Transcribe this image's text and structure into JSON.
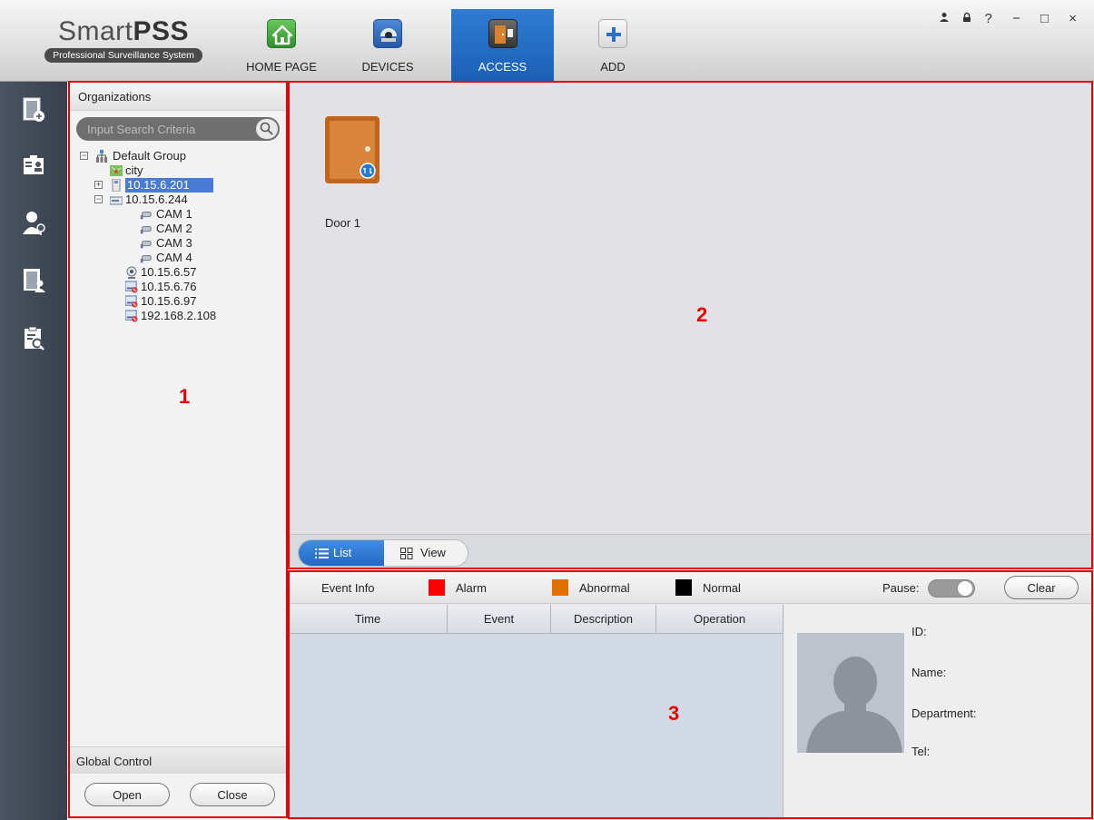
{
  "app": {
    "logo_title_light": "Smart",
    "logo_title_bold": "PSS",
    "logo_subtitle": "Professional Surveillance System"
  },
  "nav": {
    "tabs": [
      {
        "label": "HOME PAGE",
        "icon": "home-icon"
      },
      {
        "label": "DEVICES",
        "icon": "camera-dome-icon"
      },
      {
        "label": "ACCESS",
        "icon": "door-access-icon",
        "active": true
      },
      {
        "label": "ADD",
        "icon": "plus-icon"
      }
    ]
  },
  "window_controls": {
    "user": "user-icon",
    "lock": "lock-icon",
    "help": "?",
    "minimize": "−",
    "maximize": "□",
    "close": "×"
  },
  "rail": {
    "items": [
      "door-status-icon",
      "person-card-icon",
      "user-key-icon",
      "door-person-icon",
      "log-search-icon"
    ]
  },
  "panel1": {
    "title": "Organizations",
    "search_placeholder": "Input Search Criteria",
    "tree": {
      "root": "Default Group",
      "items": [
        {
          "label": "city",
          "icon": "map-icon"
        },
        {
          "label": "10.15.6.201",
          "icon": "access-controller-icon",
          "selected": true,
          "toggle": "+"
        },
        {
          "label": "10.15.6.244",
          "icon": "nvr-icon",
          "toggle": "−"
        },
        {
          "label": "CAM 1",
          "icon": "camera-icon"
        },
        {
          "label": "CAM 2",
          "icon": "camera-icon"
        },
        {
          "label": "CAM 3",
          "icon": "camera-icon"
        },
        {
          "label": "CAM 4",
          "icon": "camera-icon"
        },
        {
          "label": "10.15.6.57",
          "icon": "ipc-icon"
        },
        {
          "label": "10.15.6.76",
          "icon": "nvr-offline-icon"
        },
        {
          "label": "10.15.6.97",
          "icon": "nvr-offline-icon"
        },
        {
          "label": "192.168.2.108",
          "icon": "nvr-offline-icon"
        }
      ]
    },
    "global_control_title": "Global Control",
    "open_label": "Open",
    "close_label": "Close"
  },
  "panel2": {
    "door_label": "Door 1",
    "list_label": "List",
    "view_label": "View"
  },
  "panel3": {
    "event_info": "Event Info",
    "legend": [
      {
        "label": "Alarm",
        "color": "#ff0000"
      },
      {
        "label": "Abnormal",
        "color": "#e07000"
      },
      {
        "label": "Normal",
        "color": "#000000"
      }
    ],
    "pause_label": "Pause:",
    "clear_label": "Clear",
    "columns": [
      "Time",
      "Event",
      "Description",
      "Operation"
    ],
    "detail_fields": [
      "ID:",
      "Name:",
      "Department:",
      "Tel:"
    ]
  },
  "annotations": [
    "1",
    "2",
    "3"
  ],
  "colors": {
    "accent": "#1a5fb6",
    "annotation": "#e60000",
    "rail": "#3e4652"
  }
}
